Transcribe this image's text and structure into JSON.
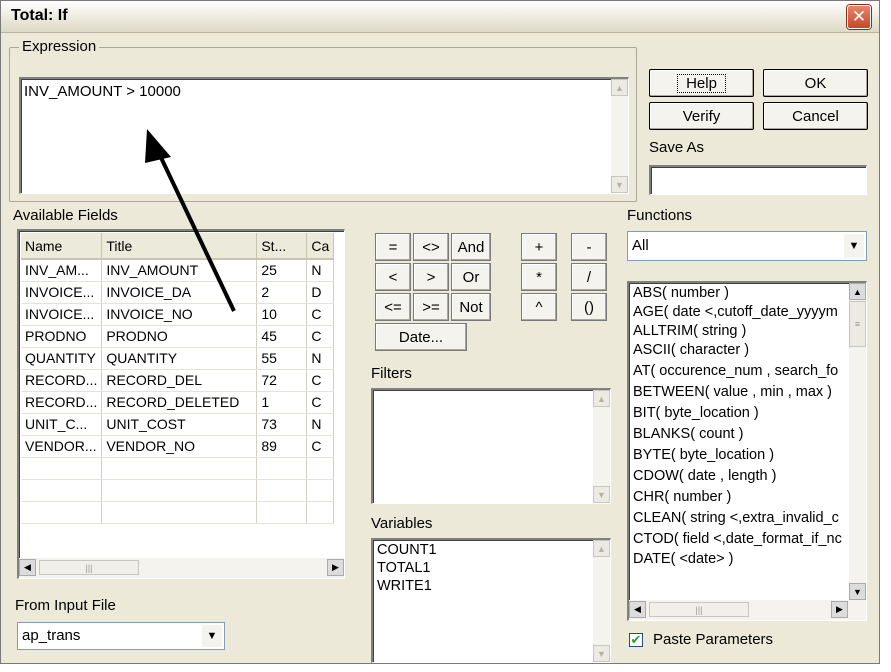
{
  "window": {
    "title": "Total: If",
    "close_glyph": "✕"
  },
  "expression": {
    "group_label": "Expression",
    "value": "INV_AMOUNT > 10000"
  },
  "buttons": {
    "help": "Help",
    "ok": "OK",
    "verify": "Verify",
    "cancel": "Cancel",
    "save_as_label": "Save As",
    "save_as_value": ""
  },
  "available_fields": {
    "label": "Available Fields",
    "columns": [
      "Name",
      "Title",
      "St...",
      "Ca"
    ],
    "rows": [
      [
        "INV_AM...",
        "INV_AMOUNT",
        "25",
        "N"
      ],
      [
        "INVOICE...",
        "INVOICE_DA",
        "2",
        "D"
      ],
      [
        "INVOICE...",
        "INVOICE_NO",
        "10",
        "C"
      ],
      [
        "PRODNO",
        "PRODNO",
        "45",
        "C"
      ],
      [
        "QUANTITY",
        "QUANTITY",
        "55",
        "N"
      ],
      [
        "RECORD...",
        "RECORD_DEL",
        "72",
        "C"
      ],
      [
        "RECORD...",
        "RECORD_DELETED",
        "1",
        "C"
      ],
      [
        "UNIT_C...",
        "UNIT_COST",
        "73",
        "N"
      ],
      [
        "VENDOR...",
        "VENDOR_NO",
        "89",
        "C"
      ]
    ]
  },
  "from_input_file": {
    "label": "From Input File",
    "value": "ap_trans"
  },
  "operators": {
    "row1": [
      "=",
      "<>",
      "And",
      "+",
      "-"
    ],
    "row2": [
      "<",
      ">",
      "Or",
      "*",
      "/"
    ],
    "row3": [
      "<=",
      ">=",
      "Not",
      "^",
      "()"
    ],
    "date": "Date..."
  },
  "filters": {
    "label": "Filters",
    "items": []
  },
  "variables": {
    "label": "Variables",
    "items": [
      "COUNT1",
      "TOTAL1",
      "WRITE1"
    ]
  },
  "functions": {
    "label": "Functions",
    "category": "All",
    "items": [
      "ABS( number )",
      "AGE( date <,cutoff_date_yyyym",
      "ALLTRIM( string )",
      "ASCII( character )",
      "AT( occurence_num , search_fo",
      "BETWEEN( value , min , max )",
      "BIT( byte_location )",
      "BLANKS( count )",
      "BYTE( byte_location )",
      "CDOW( date , length )",
      "CHR( number )",
      "CLEAN( string <,extra_invalid_c",
      "CTOD( field <,date_format_if_nc",
      "DATE( <date> )"
    ]
  },
  "paste_parameters": {
    "label": "Paste Parameters",
    "checked": true,
    "check_glyph": "✔"
  },
  "annotation": {
    "arrow_color": "#000000"
  }
}
